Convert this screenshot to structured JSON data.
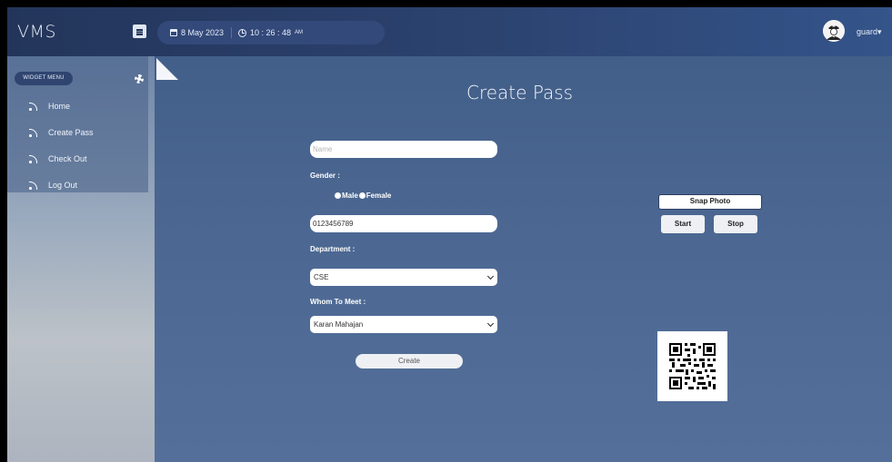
{
  "app": {
    "brand": "VMS"
  },
  "header": {
    "date": "8 May 2023",
    "time": "10 : 26 : 48",
    "ampm": "AM",
    "user": "guard",
    "user_caret": "▾"
  },
  "sidebar": {
    "widget_label": "WIDGET MENU",
    "items": [
      {
        "label": "Home",
        "icon": "rss-icon"
      },
      {
        "label": "Create Pass",
        "icon": "rss-icon"
      },
      {
        "label": "Check Out",
        "icon": "rss-icon"
      },
      {
        "label": "Log Out",
        "icon": "rss-icon"
      }
    ]
  },
  "form": {
    "title": "Create Pass",
    "name_placeholder": "Name",
    "name_value": "",
    "gender_label": "Gender :",
    "gender_male": "Male",
    "gender_female": "Female",
    "phone_value": "0123456789",
    "department_label": "Department :",
    "department_value": "CSE",
    "whom_label": "Whom To Meet :",
    "whom_value": "Karan Mahajan",
    "create_label": "Create"
  },
  "camera": {
    "snap_label": "Snap Photo",
    "start_label": "Start",
    "stop_label": "Stop"
  },
  "colors": {
    "topbar": "#2c4370",
    "background": "#4a6690",
    "sidebar": "#9aaabe"
  }
}
